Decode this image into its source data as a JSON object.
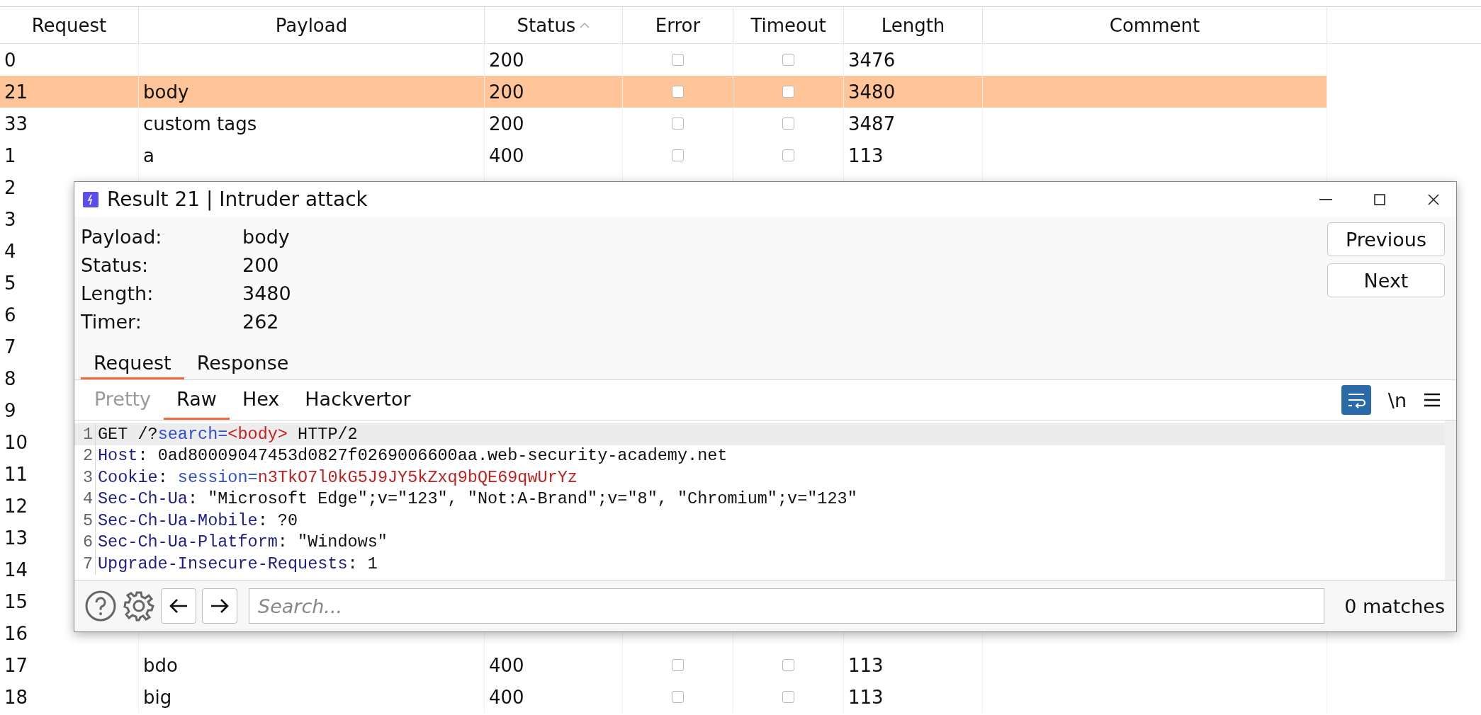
{
  "table": {
    "columns": [
      {
        "label": "Request",
        "sorted": false
      },
      {
        "label": "Payload",
        "sorted": false
      },
      {
        "label": "Status",
        "sorted": true
      },
      {
        "label": "Error",
        "sorted": false
      },
      {
        "label": "Timeout",
        "sorted": false
      },
      {
        "label": "Length",
        "sorted": false
      },
      {
        "label": "Comment",
        "sorted": false
      }
    ],
    "rows": [
      {
        "request": "0",
        "status": "200",
        "error": false,
        "timeout": false,
        "length": "3476",
        "selected": false
      },
      {
        "request": "21",
        "payload": "body",
        "status": "200",
        "error": false,
        "timeout": false,
        "length": "3480",
        "selected": true
      },
      {
        "request": "33",
        "payload": "custom tags",
        "status": "200",
        "error": false,
        "timeout": false,
        "length": "3487",
        "selected": false
      },
      {
        "request": "1",
        "payload": "a",
        "status": "400",
        "error": false,
        "timeout": false,
        "length": "113",
        "selected": false
      },
      {
        "request": "2",
        "selected": false
      },
      {
        "request": "3",
        "selected": false
      },
      {
        "request": "4",
        "selected": false
      },
      {
        "request": "5",
        "selected": false
      },
      {
        "request": "6",
        "selected": false
      },
      {
        "request": "7",
        "selected": false
      },
      {
        "request": "8",
        "selected": false
      },
      {
        "request": "9",
        "selected": false
      },
      {
        "request": "10",
        "selected": false
      },
      {
        "request": "11",
        "selected": false
      },
      {
        "request": "12",
        "selected": false
      },
      {
        "request": "13",
        "selected": false
      },
      {
        "request": "14",
        "selected": false
      },
      {
        "request": "15",
        "selected": false
      },
      {
        "request": "16",
        "selected": false
      },
      {
        "request": "17",
        "payload": "bdo",
        "status": "400",
        "error": false,
        "timeout": false,
        "length": "113",
        "selected": false
      },
      {
        "request": "18",
        "payload": "big",
        "status": "400",
        "error": false,
        "timeout": false,
        "length": "113",
        "selected": false
      }
    ]
  },
  "dialog": {
    "title": "Result 21 | Intruder attack",
    "details": [
      {
        "label": "Payload:",
        "value": "body"
      },
      {
        "label": "Status:",
        "value": "200"
      },
      {
        "label": "Length:",
        "value": "3480"
      },
      {
        "label": "Timer:",
        "value": "262"
      }
    ],
    "buttons": [
      "Previous",
      "Next"
    ],
    "tabs": [
      {
        "label": "Request",
        "selected": true
      },
      {
        "label": "Response",
        "selected": false
      }
    ],
    "view_tabs": [
      {
        "label": "Pretty",
        "selected": false,
        "disabled": true
      },
      {
        "label": "Raw",
        "selected": true,
        "disabled": false
      },
      {
        "label": "Hex",
        "selected": false,
        "disabled": false
      },
      {
        "label": "Hackvertor",
        "selected": false,
        "disabled": false
      }
    ],
    "wrap_on": true,
    "newline_toggle": "\\n",
    "lines": [
      {
        "number": "1",
        "highlighted": true,
        "parts": [
          {
            "kind": "plain",
            "text": "GET /?"
          },
          {
            "kind": "param",
            "text": "search="
          },
          {
            "kind": "value",
            "text": "<body>"
          },
          {
            "kind": "plain",
            "text": " HTTP/2"
          }
        ]
      },
      {
        "number": "2",
        "highlighted": false,
        "parts": [
          {
            "kind": "header",
            "text": "Host"
          },
          {
            "kind": "plain",
            "text": ": 0ad80009047453d0827f0269006600aa.web-security-academy.net"
          }
        ]
      },
      {
        "number": "3",
        "highlighted": false,
        "parts": [
          {
            "kind": "header",
            "text": "Cookie"
          },
          {
            "kind": "plain",
            "text": ": "
          },
          {
            "kind": "param",
            "text": "session="
          },
          {
            "kind": "value",
            "text": "n3TkO7l0kG5J9JY5kZxq9bQE69qwUrYz"
          }
        ]
      },
      {
        "number": "4",
        "highlighted": false,
        "parts": [
          {
            "kind": "header",
            "text": "Sec-Ch-Ua"
          },
          {
            "kind": "plain",
            "text": ": \"Microsoft Edge\";v=\"123\", \"Not:A-Brand\";v=\"8\", \"Chromium\";v=\"123\""
          }
        ]
      },
      {
        "number": "5",
        "highlighted": false,
        "parts": [
          {
            "kind": "header",
            "text": "Sec-Ch-Ua-Mobile"
          },
          {
            "kind": "plain",
            "text": ": ?0"
          }
        ]
      },
      {
        "number": "6",
        "highlighted": false,
        "parts": [
          {
            "kind": "header",
            "text": "Sec-Ch-Ua-Platform"
          },
          {
            "kind": "plain",
            "text": ": \"Windows\""
          }
        ]
      },
      {
        "number": "7",
        "highlighted": false,
        "parts": [
          {
            "kind": "header",
            "text": "Upgrade-Insecure-Requests"
          },
          {
            "kind": "plain",
            "text": ": 1"
          }
        ]
      }
    ],
    "search": {
      "placeholder": "Search..."
    },
    "matches": "0 matches"
  }
}
